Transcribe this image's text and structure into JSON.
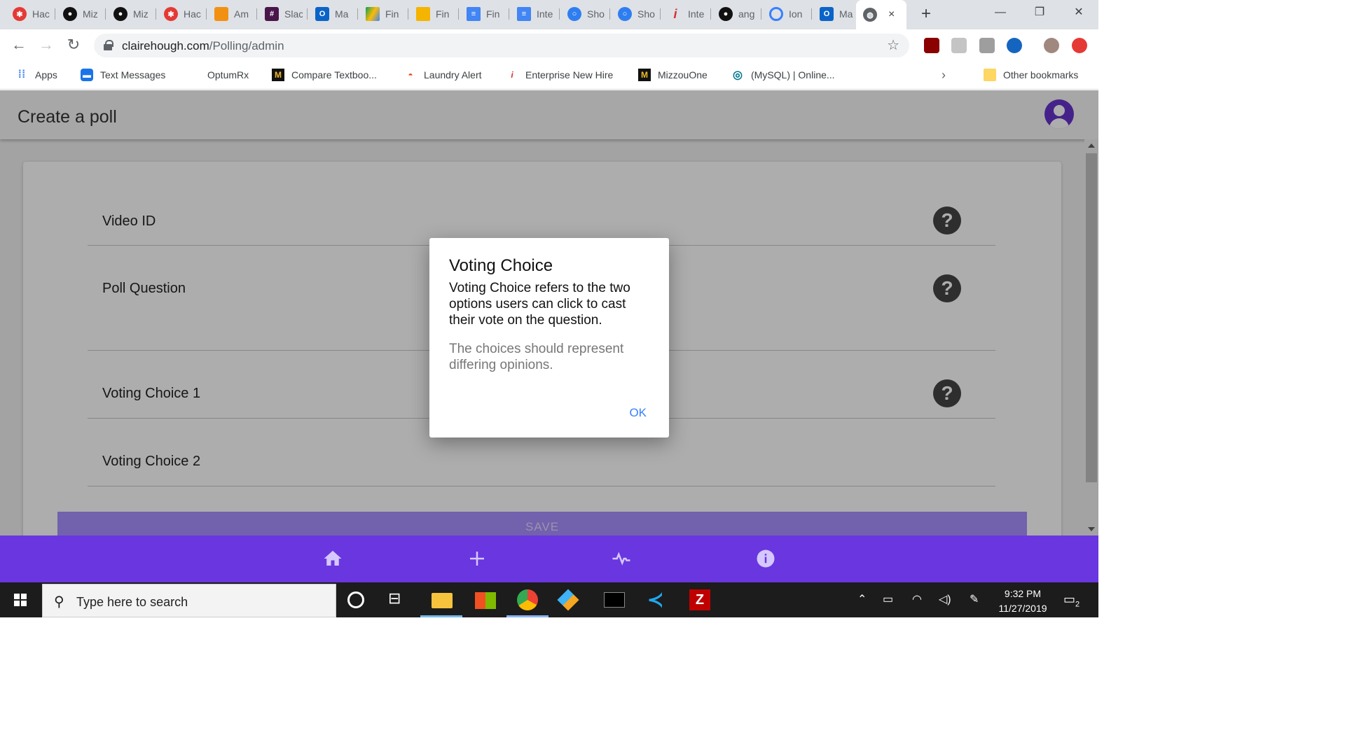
{
  "browser": {
    "tabs": [
      {
        "label": "Hac",
        "icon": "hack-icon"
      },
      {
        "label": "Miz",
        "icon": "github-icon"
      },
      {
        "label": "Miz",
        "icon": "github-icon"
      },
      {
        "label": "Hac",
        "icon": "hack-icon"
      },
      {
        "label": "Am",
        "icon": "aws-icon"
      },
      {
        "label": "Slac",
        "icon": "slack-icon"
      },
      {
        "label": "Ma",
        "icon": "outlook-icon"
      },
      {
        "label": "Fin",
        "icon": "drive-icon"
      },
      {
        "label": "Fin",
        "icon": "slides-icon"
      },
      {
        "label": "Fin",
        "icon": "docs-icon"
      },
      {
        "label": "Inte",
        "icon": "docs-icon"
      },
      {
        "label": "Sho",
        "icon": "circle-icon"
      },
      {
        "label": "Sho",
        "icon": "circle-icon"
      },
      {
        "label": "Inte",
        "icon": "info-icon"
      },
      {
        "label": "ang",
        "icon": "github-icon"
      },
      {
        "label": "Ion",
        "icon": "ionic-icon"
      },
      {
        "label": "Ma",
        "icon": "outlook-icon"
      }
    ],
    "active_tab_close": "×",
    "new_tab": "+",
    "window_controls": {
      "minimize": "—",
      "restore": "❐",
      "close": "✕"
    },
    "url_host": "clairehough.com",
    "url_path": "/Polling/admin"
  },
  "bookmarks": [
    {
      "label": "Apps"
    },
    {
      "label": "Text Messages"
    },
    {
      "label": "OptumRx"
    },
    {
      "label": "Compare Textboo..."
    },
    {
      "label": "Laundry Alert"
    },
    {
      "label": "Enterprise New Hire"
    },
    {
      "label": "MizzouOne"
    },
    {
      "label": "(MySQL) | Online..."
    },
    {
      "label": "Other bookmarks"
    }
  ],
  "app": {
    "title": "Create a poll",
    "fields": [
      {
        "label": "Video ID"
      },
      {
        "label": "Poll Question"
      },
      {
        "label": "Voting Choice 1"
      },
      {
        "label": "Voting Choice 2"
      }
    ],
    "help_glyph": "?",
    "save_label": "SAVE",
    "accent": "#6a36e0"
  },
  "dialog": {
    "title": "Voting Choice",
    "message": "Voting Choice refers to the two options users can click to cast their vote on the question.",
    "sub_message": "The choices should represent differing opinions.",
    "ok_label": "OK"
  },
  "taskbar": {
    "search_placeholder": "Type here to search",
    "time": "9:32 PM",
    "date": "11/27/2019",
    "notifications": "2"
  }
}
